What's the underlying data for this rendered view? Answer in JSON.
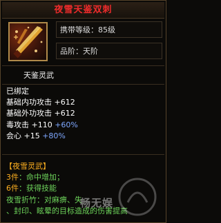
{
  "item": {
    "name": "夜雪天鉴双刺",
    "carry_level_label": "携带等级：",
    "carry_level_value": "85级",
    "grade_label": "品阶：",
    "grade_value": "天阶",
    "subtitle": "天鉴灵武",
    "bound_status": "已绑定",
    "stats": [
      {
        "label": "基础内功攻击",
        "value": "+612",
        "bonus": ""
      },
      {
        "label": "基础外功攻击",
        "value": "+612",
        "bonus": ""
      },
      {
        "label": "毒攻击",
        "value": "+110",
        "bonus": "+60%"
      },
      {
        "label": "会心",
        "value": "+15",
        "bonus": "+80%"
      }
    ],
    "set_name": "【夜雪灵武】",
    "set_bonuses": [
      {
        "count": "3件",
        "effect": "：命中增加；"
      },
      {
        "count": "6件",
        "effect": "：获得技能"
      }
    ],
    "skill_line_1": "夜雪折竹：对麻痹、失",
    "skill_line_2": "、封印、眩晕的目标造成的伤害提高",
    "watermark": "畅无娱"
  },
  "colors": {
    "title": "#ee2b2b",
    "set_name": "#ffb020",
    "set_bonus": "#6dd35a",
    "stat_bonus": "#7fa8ff"
  },
  "icons": [
    "dual-dagger-icon",
    "watermark-logo-icon"
  ]
}
